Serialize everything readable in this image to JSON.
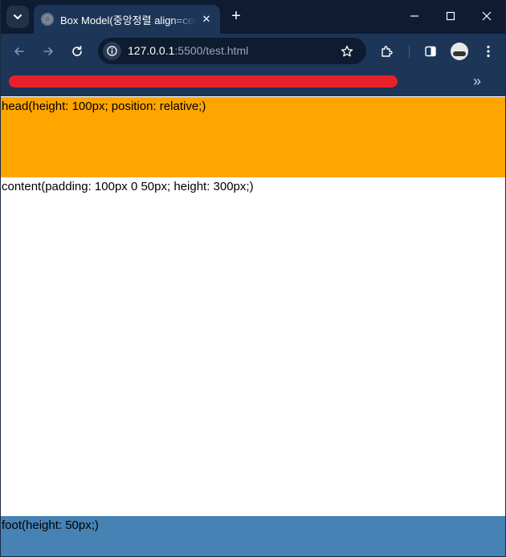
{
  "browser": {
    "tab": {
      "title": "Box Model(중앙정렬 align=center)",
      "close_glyph": "✕"
    },
    "new_tab_glyph": "+",
    "address": {
      "host": "127.0.0.1",
      "path": ":5500/test.html"
    },
    "bookmarks": {
      "overflow_glyph": "»"
    },
    "icons": [
      "tab-search-icon",
      "globe-icon",
      "close-icon",
      "plus-icon",
      "minimize-icon",
      "maximize-icon",
      "window-close-icon",
      "back-arrow-icon",
      "forward-arrow-icon",
      "reload-icon",
      "site-info-icon",
      "bookmark-star-icon",
      "extensions-icon",
      "side-panel-icon",
      "profile-avatar",
      "kebab-menu-icon"
    ],
    "colors": {
      "titlebar": "#0e1b30",
      "toolbar": "#1d3557",
      "redaction": "#e8202a"
    }
  },
  "page": {
    "head": {
      "text": "head(height: 100px; position: relative;)",
      "color": "#ffa500"
    },
    "content": {
      "text": "content(padding: 100px 0 50px; height: 300px;)",
      "color": "#ffffff"
    },
    "foot": {
      "text": "foot(height: 50px;)",
      "color": "#4682b4"
    }
  }
}
